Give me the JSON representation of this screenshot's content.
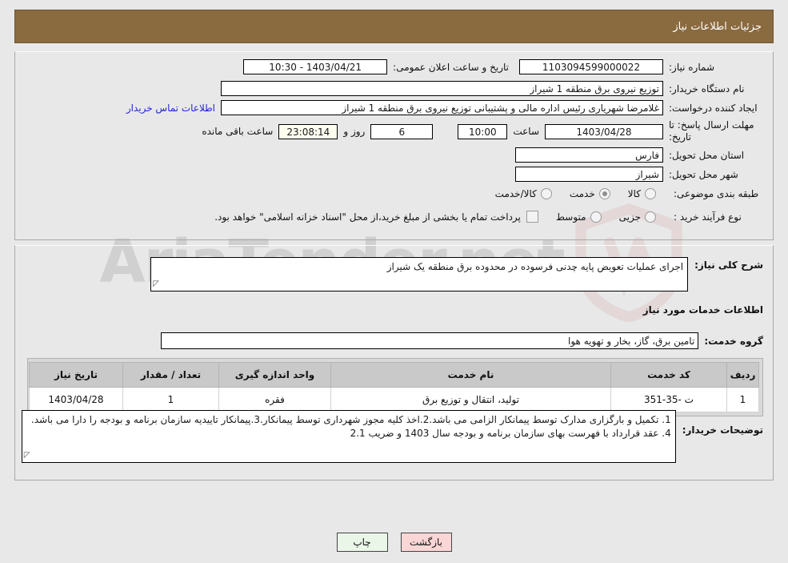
{
  "header": {
    "title": "جزئیات اطلاعات نیاز",
    "bar_color": "#8a6a3f"
  },
  "watermark": {
    "text": "AriaTender.net"
  },
  "form": {
    "need_number_label": "شماره نیاز:",
    "need_number_value": "1103094599000022",
    "announce_label": "تاریخ و ساعت اعلان عمومی:",
    "announce_value": "1403/04/21 - 10:30",
    "buyer_org_label": "نام دستگاه خریدار:",
    "buyer_org_value": "توزیع نیروی برق منطقه 1 شیراز",
    "creator_label": "ایجاد کننده درخواست:",
    "creator_value": "غلامرضا شهریاری رئیس اداره مالی و پشتیبانی  توزیع نیروی برق منطقه 1 شیراز",
    "contact_link": "اطلاعات تماس خریدار",
    "deadline_label": "مهلت ارسال پاسخ: تا تاریخ:",
    "deadline_date": "1403/04/28",
    "hour_label": "ساعت",
    "deadline_time": "10:00",
    "days_value": "6",
    "days_label": "روز و",
    "countdown_value": "23:08:14",
    "remaining_label": "ساعت باقی مانده",
    "province_label": "استان محل تحویل:",
    "province_value": "فارس",
    "city_label": "شهر محل تحویل:",
    "city_value": "شیراز",
    "category_label": "طبقه بندی موضوعی:",
    "category_options": [
      {
        "label": "کالا",
        "selected": false
      },
      {
        "label": "خدمت",
        "selected": true
      },
      {
        "label": "کالا/خدمت",
        "selected": false
      }
    ],
    "process_label": "نوع فرآیند خرید :",
    "process_options": [
      {
        "label": "جزیی",
        "selected": false
      },
      {
        "label": "متوسط",
        "selected": false
      }
    ],
    "treasury_checkbox_label": "پرداخت تمام یا بخشی از مبلغ خرید،از محل \"اسناد خزانه اسلامی\" خواهد بود."
  },
  "details": {
    "summary_label": "شرح کلی نیاز:",
    "summary_value": "اجرای عملیات تعویض پایه چدنی فرسوده در محدوده برق منطقه یک شیراز",
    "services_section_title": "اطلاعات خدمات مورد نیاز",
    "service_group_label": "گروه خدمت:",
    "service_group_value": "تامین برق، گاز، بخار و تهویه هوا"
  },
  "table": {
    "columns": [
      "ردیف",
      "کد خدمت",
      "نام خدمت",
      "واحد اندازه گیری",
      "تعداد / مقدار",
      "تاریخ نیاز"
    ],
    "rows": [
      {
        "row": "1",
        "code": "ت -35-351",
        "name": "تولید، انتقال و توزیع برق",
        "unit": "فقره",
        "qty": "1",
        "date": "1403/04/28"
      }
    ]
  },
  "notes": {
    "label": "توضیحات خریدار:",
    "value": "1. تکمیل و بارگزاری مدارک توسط پیمانکار الزامی می باشد.2.اخذ کلیه مجوز شهرداری توسط پیمانکار.3.پیمانکار تاییدیه سازمان برنامه و بودجه را دارا می باشد. 4. عقد قرارداد با فهرست بهای سازمان برنامه و بودجه سال 1403 و ضریب 2.1"
  },
  "buttons": {
    "print": "چاپ",
    "back": "بازگشت"
  }
}
